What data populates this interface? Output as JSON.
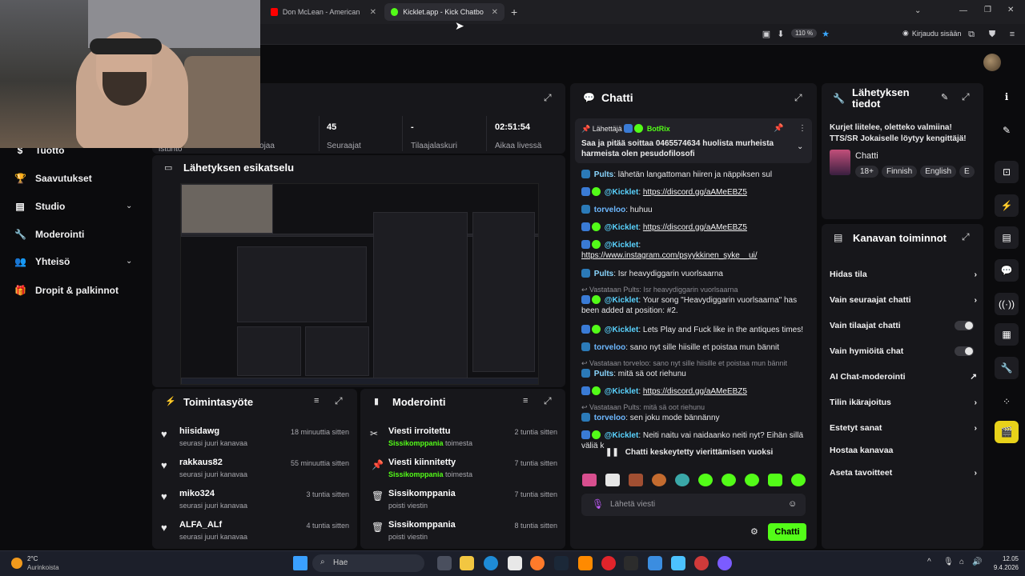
{
  "browser": {
    "tabs": [
      {
        "label": "Don McLean - American Pie (Ly",
        "favicon_color": "#ff0000"
      },
      {
        "label": "Kicklet.app - Kick Chatbot and",
        "favicon_color": "#53fc18"
      }
    ],
    "new_tab": "+",
    "zoom": "110 %",
    "signin": "Kirjaudu sisään"
  },
  "sidebar": {
    "items": [
      {
        "label": "Tuotto",
        "icon": "money-icon"
      },
      {
        "label": "Saavutukset",
        "icon": "trophy-icon"
      },
      {
        "label": "Studio",
        "icon": "layout-icon"
      },
      {
        "label": "Moderointi",
        "icon": "wrench-icon"
      },
      {
        "label": "Yhteisö",
        "icon": "people-icon"
      },
      {
        "label": "Dropit & palkinnot",
        "icon": "gift-icon"
      }
    ]
  },
  "stats": {
    "items": [
      {
        "value": "",
        "label": "istunto"
      },
      {
        "value": "",
        "label": "Katsojaa"
      },
      {
        "value": "45",
        "label": "Seuraajat"
      },
      {
        "value": "-",
        "label": "Tilaajalaskuri"
      },
      {
        "value": "02:51:54",
        "label": "Aikaa livessä"
      }
    ]
  },
  "preview": {
    "title": "Lähetyksen esikatselu"
  },
  "activity": {
    "title": "Toimintasyöte",
    "rows": [
      {
        "name": "hiisidawg",
        "sub": "seurasi juuri kanavaa",
        "time": "18 minuuttia sitten"
      },
      {
        "name": "rakkaus82",
        "sub": "seurasi juuri kanavaa",
        "time": "55 minuuttia sitten"
      },
      {
        "name": "miko324",
        "sub": "seurasi juuri kanavaa",
        "time": "3 tuntia sitten"
      },
      {
        "name": "ALFA_ALf",
        "sub": "seurasi juuri kanavaa",
        "time": "4 tuntia sitten"
      }
    ]
  },
  "moderation": {
    "title": "Moderointi",
    "rows": [
      {
        "name": "Viesti irroitettu",
        "actor": "Sissikomppania",
        "action": "toimesta",
        "time": "2 tuntia sitten"
      },
      {
        "name": "Viesti kiinnitetty",
        "actor": "Sissikomppania",
        "action": "toimesta",
        "time": "7 tuntia sitten"
      },
      {
        "name": "Sissikomppania",
        "actor": "",
        "action": "poisti viestin",
        "time": "7 tuntia sitten"
      },
      {
        "name": "Sissikomppania",
        "actor": "",
        "action": "poisti viestin",
        "time": "8 tuntia sitten"
      }
    ]
  },
  "chat": {
    "title": "Chatti",
    "pinned": {
      "label": "Lähettäjä",
      "sender": "BotRix",
      "text": "Saa ja pitää soittaa 0465574634 huolista murheista harmeista olen pesudofilosofi"
    },
    "messages": [
      {
        "user": "Pults",
        "text": "lähetän langattoman hiiren ja näppiksen sul",
        "reply": ""
      },
      {
        "user": "@Kicklet",
        "text": "https://discord.gg/aAMeEBZ5",
        "reply": ""
      },
      {
        "user": "torveloo",
        "text": "huhuu",
        "reply": ""
      },
      {
        "user": "@Kicklet",
        "text": "https://discord.gg/aAMeEBZ5",
        "reply": ""
      },
      {
        "user": "@Kicklet",
        "text": "https://www.instagram.com/psyykkinen_syke__ui/",
        "reply": ""
      },
      {
        "user": "Pults",
        "text": "Isr heavydiggarin vuorlsaarna",
        "reply": ""
      },
      {
        "user": "@Kicklet",
        "text": "Your song \"Heavydiggarin vuorlsaarna\" has been added at position: #2.",
        "reply": "Vastataan Pults: Isr heavydiggarin vuorlsaarna"
      },
      {
        "user": "@Kicklet",
        "text": "Lets Play and Fuck like in the antiques times!",
        "reply": ""
      },
      {
        "user": "torveloo",
        "text": "sano nyt sille hiisille et poistaa mun bännit",
        "reply": ""
      },
      {
        "user": "Pults",
        "text": "mitä sä oot riehunu",
        "reply": "Vastataan torveloo: sano nyt sille hiisille et poistaa mun bännit"
      },
      {
        "user": "@Kicklet",
        "text": "https://discord.gg/aAMeEBZ5",
        "reply": ""
      },
      {
        "user": "torveloo",
        "text": "sen joku mode bännänny",
        "reply": "Vastataan Pults: mitä sä oot riehunu"
      },
      {
        "user": "@Kicklet",
        "text": "Neiti naitu vai naidaanko neiti nyt? Eihän sillä väliä k",
        "reply": ""
      }
    ],
    "paused": "Chatti keskeytetty vierittämisen vuoksi",
    "input_placeholder": "Lähetä viesti",
    "send": "Chatti"
  },
  "info": {
    "title": "Lähetyksen tiedot",
    "stream_title": "Kurjet liitelee, oletteko valmiina! TTS/SR Jokaiselle löytyy kengittäjä!",
    "category": "Chatti",
    "tags": [
      "18+",
      "Finnish",
      "English",
      "E"
    ]
  },
  "actions": {
    "title": "Kanavan toiminnot",
    "rows": [
      {
        "label": "Hidas tila",
        "control": "arrow"
      },
      {
        "label": "Vain seuraajat chatti",
        "control": "arrow"
      },
      {
        "label": "Vain tilaajat chatti",
        "control": "toggle"
      },
      {
        "label": "Vain hymiöitä chat",
        "control": "toggle"
      },
      {
        "label": "AI Chat-moderointi",
        "control": "external"
      },
      {
        "label": "Tilin ikärajoitus",
        "control": "arrow"
      },
      {
        "label": "Estetyt sanat",
        "control": "arrow"
      },
      {
        "label": "Hostaa kanavaa",
        "control": "none"
      },
      {
        "label": "Aseta tavoitteet",
        "control": "arrow"
      }
    ]
  },
  "taskbar": {
    "weather_temp": "2°C",
    "weather_text": "Aurinkoista",
    "search": "Hae",
    "time": "12.05",
    "date": "9.4.2026"
  },
  "colors": {
    "accent": "#53fc18",
    "panel": "#17171b",
    "bg": "#0b0b0d"
  }
}
